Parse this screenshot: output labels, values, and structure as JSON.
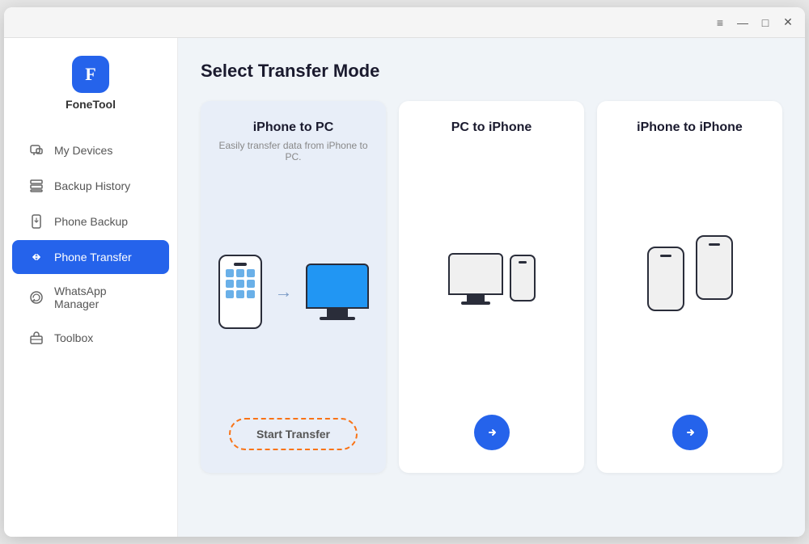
{
  "app": {
    "name": "FoneTool"
  },
  "titlebar": {
    "menu_icon": "≡",
    "minimize_icon": "—",
    "maximize_icon": "□",
    "close_icon": "✕"
  },
  "sidebar": {
    "logo_label": "FoneTool",
    "items": [
      {
        "id": "my-devices",
        "label": "My Devices",
        "active": false
      },
      {
        "id": "backup-history",
        "label": "Backup History",
        "active": false
      },
      {
        "id": "phone-backup",
        "label": "Phone Backup",
        "active": false
      },
      {
        "id": "phone-transfer",
        "label": "Phone Transfer",
        "active": true
      },
      {
        "id": "whatsapp-manager",
        "label": "WhatsApp Manager",
        "active": false
      },
      {
        "id": "toolbox",
        "label": "Toolbox",
        "active": false
      }
    ]
  },
  "main": {
    "page_title": "Select Transfer Mode",
    "cards": [
      {
        "id": "iphone-to-pc",
        "title": "iPhone to PC",
        "description": "Easily transfer data from iPhone to PC.",
        "button_label": "Start Transfer",
        "highlighted": true
      },
      {
        "id": "pc-to-iphone",
        "title": "PC to iPhone",
        "description": "",
        "button_label": "→",
        "highlighted": false
      },
      {
        "id": "iphone-to-iphone",
        "title": "iPhone to iPhone",
        "description": "",
        "button_label": "→",
        "highlighted": false
      }
    ]
  }
}
